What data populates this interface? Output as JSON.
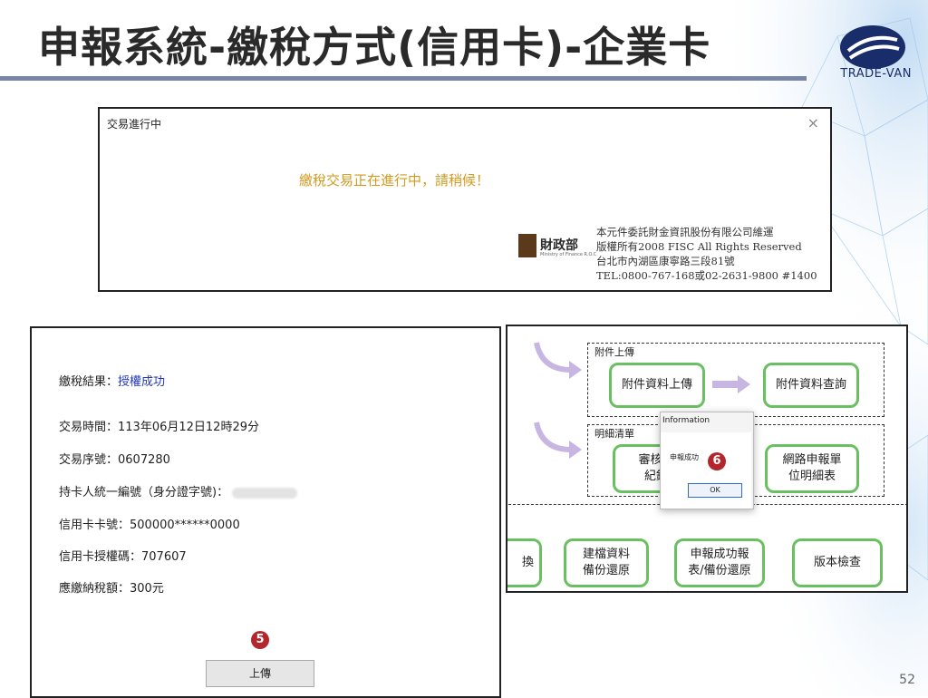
{
  "header": {
    "title": "申報系統-繳稅方式(信用卡)-企業卡",
    "logo_text": "TRADE-VAN"
  },
  "processing_dialog": {
    "title": "交易進行中",
    "close": "×",
    "message": "繳稅交易正在進行中，請稍候！",
    "seal_name": "財政部",
    "seal_sub": "Ministry of Finance R.O.C",
    "copyright": [
      "本元件委託財金資訊股份有限公司維運",
      "版權所有2008 FISC All Rights Reserved",
      "台北市內湖區康寧路三段81號",
      "TEL:0800-767-168或02-2631-9800 #1400"
    ]
  },
  "result_panel": {
    "result_label": "繳稅結果：",
    "result_value": "授權成功",
    "time": "交易時間：113年06月12日12時29分",
    "serial": "交易序號：0607280",
    "holder_id_label": "持卡人統一編號（身分證字號)：",
    "card_number": "信用卡卡號：500000******0000",
    "auth_code": "信用卡授權碼：707607",
    "tax_amount": "應繳納稅額：300元",
    "step_badge": "5",
    "upload_button": "上傳"
  },
  "flow_panel": {
    "group1_label": "附件上傳",
    "attach_upload": "附件資料上傳",
    "attach_query": "附件資料查詢",
    "group2_label": "明細清單",
    "review_line1": "審核及",
    "review_line2": "紀錄",
    "online_line1": "網路申報單",
    "online_line2": "位明細表",
    "partial_left": "換",
    "backup_line1": "建檔資料",
    "backup_line2": "備份還原",
    "report_line1": "申報成功報",
    "report_line2": "表/備份還原",
    "version_check": "版本檢查",
    "info_dialog": {
      "title": "Information",
      "message": "申報成功",
      "ok": "OK"
    },
    "step_badge": "6"
  },
  "page_number": "52",
  "colors": {
    "accent_green": "#6abf60",
    "badge_red": "#b3262c",
    "message_yellow": "#d29b1f",
    "success_blue": "#2036b8"
  }
}
